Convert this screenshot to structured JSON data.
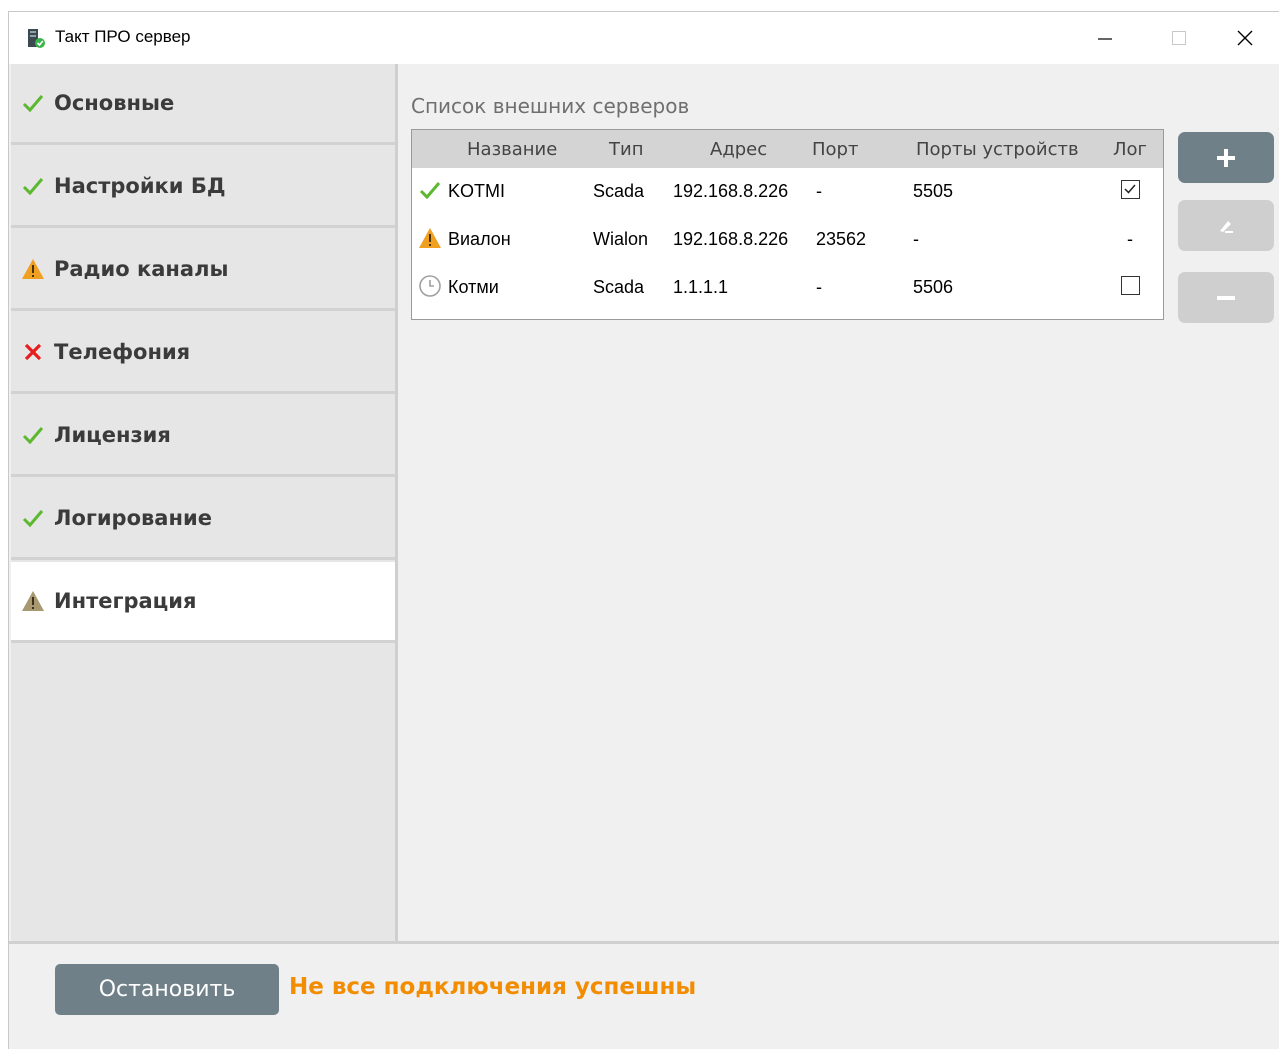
{
  "window": {
    "title": "Такт ПРО сервер",
    "controls": [
      "minimize",
      "maximize",
      "close"
    ]
  },
  "sidebar": {
    "items": [
      {
        "label": "Основные",
        "status": "ok",
        "icon": "check-icon"
      },
      {
        "label": "Настройки БД",
        "status": "ok",
        "icon": "check-icon"
      },
      {
        "label": "Радио каналы",
        "status": "warning",
        "icon": "warning-icon"
      },
      {
        "label": "Телефония",
        "status": "error",
        "icon": "cross-icon"
      },
      {
        "label": "Лицензия",
        "status": "ok",
        "icon": "check-icon"
      },
      {
        "label": "Логирование",
        "status": "ok",
        "icon": "check-icon"
      },
      {
        "label": "Интеграция",
        "status": "warning-muted",
        "icon": "warning-icon",
        "active": true
      }
    ]
  },
  "main": {
    "section_title": "Список внешних серверов",
    "table": {
      "columns": [
        "Название",
        "Тип",
        "Адрес",
        "Порт",
        "Порты устройств",
        "Лог"
      ],
      "rows": [
        {
          "status": "ok",
          "name": "KOTMI",
          "type": "Scada",
          "address": "192.168.8.226",
          "port": "-",
          "device_ports": "5505",
          "log": "checked"
        },
        {
          "status": "warning",
          "name": "Виалон",
          "type": "Wialon",
          "address": "192.168.8.226",
          "port": "23562",
          "device_ports": "-",
          "log": "-"
        },
        {
          "status": "pending",
          "name": "Котми",
          "type": "Scada",
          "address": "1.1.1.1",
          "port": "-",
          "device_ports": "5506",
          "log": "unchecked"
        }
      ]
    },
    "buttons": {
      "add": {
        "icon": "plus-icon",
        "enabled": true
      },
      "edit": {
        "icon": "pencil-icon",
        "enabled": false
      },
      "remove": {
        "icon": "minus-icon",
        "enabled": false
      }
    }
  },
  "footer": {
    "stop_label": "Остановить",
    "status_message": "Не все подключения успешны"
  },
  "colors": {
    "ok": "#5cb82e",
    "warning": "#f0a020",
    "warning_muted": "#a89870",
    "error": "#e81c1c",
    "accent_button": "#6f8088",
    "status_text": "#f28c00"
  }
}
